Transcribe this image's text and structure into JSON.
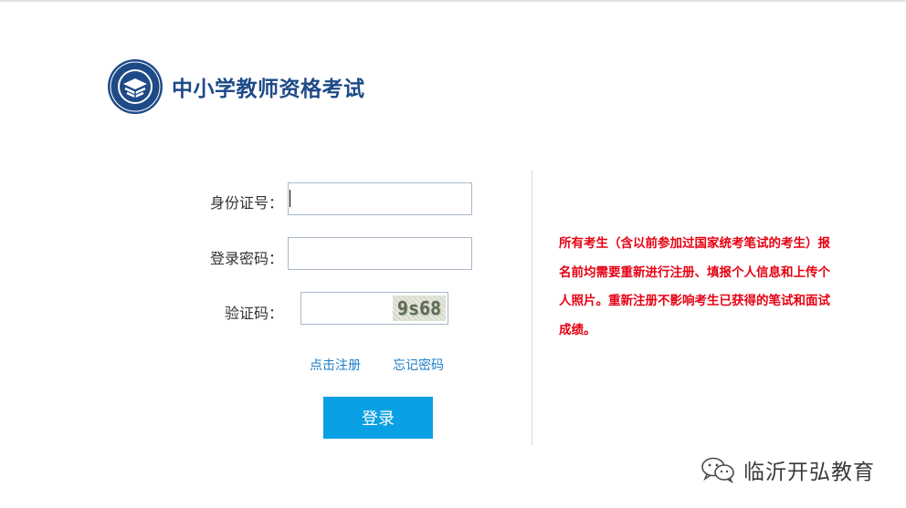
{
  "header": {
    "title": "中小学教师资格考试",
    "logo_icon": "book-emblem-icon",
    "brand_color": "#1e4a88"
  },
  "form": {
    "id_label": "身份证号：",
    "id_value": "",
    "password_label": "登录密码：",
    "password_value": "",
    "captcha_label": "验证码：",
    "captcha_value": "",
    "captcha_image_text": "9s68",
    "register_link": "点击注册",
    "forgot_link": "忘记密码",
    "login_button": "登录",
    "button_color": "#0aa0e4",
    "link_color": "#1f7ec6"
  },
  "notice": {
    "text": "所有考生（含以前参加过国家统考笔试的考生）报名前均需要重新进行注册、填报个人信息和上传个人照片。重新注册不影响考生已获得的笔试和面试成绩。",
    "color": "#e60012"
  },
  "watermark": {
    "icon": "wechat-icon",
    "text": "临沂开弘教育"
  }
}
